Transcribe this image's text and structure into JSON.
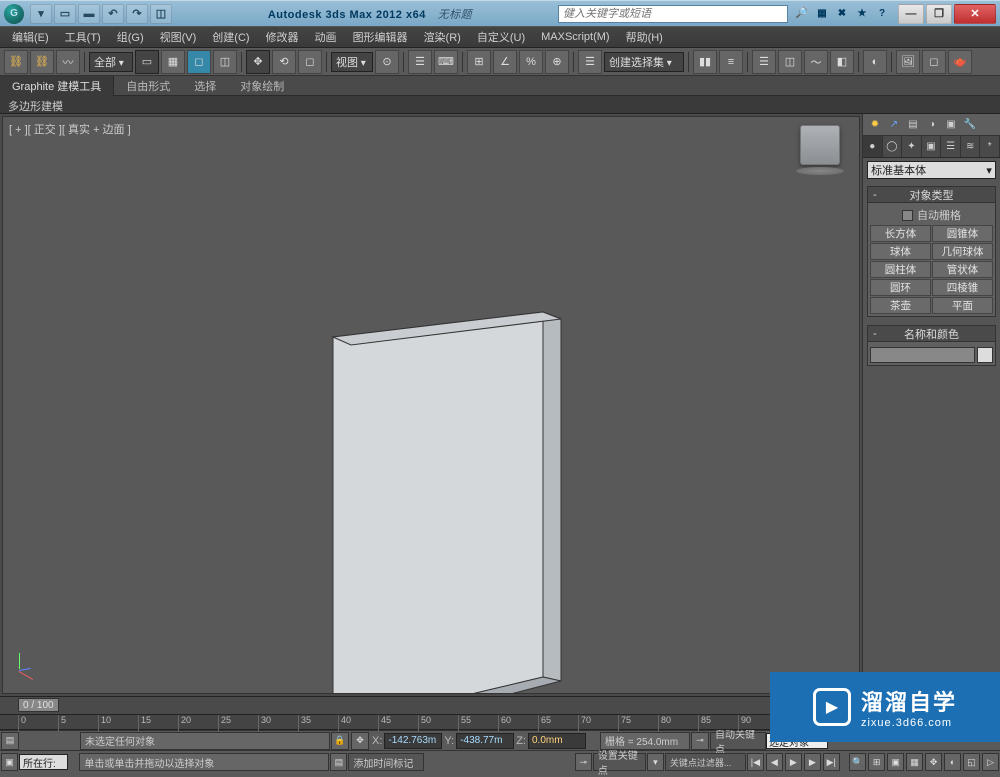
{
  "titlebar": {
    "app_title": "Autodesk 3ds Max  2012  x64",
    "file_title": "无标题",
    "search_placeholder": "健入关键字或短语",
    "minimize": "—",
    "maximize": "❐",
    "close": "✕"
  },
  "menubar": {
    "items": [
      "编辑(E)",
      "工具(T)",
      "组(G)",
      "视图(V)",
      "创建(C)",
      "修改器",
      "动画",
      "图形编辑器",
      "渲染(R)",
      "自定义(U)",
      "MAXScript(M)",
      "帮助(H)"
    ]
  },
  "toolbar": {
    "selset_label": "全部",
    "view_label": "视图",
    "named_sel_label": "创建选择集"
  },
  "ribbon": {
    "tabs": [
      "Graphite 建模工具",
      "自由形式",
      "选择",
      "对象绘制"
    ],
    "sub_label": "多边形建模"
  },
  "viewport": {
    "label": "[ + ][ 正交 ][ 真实 + 边面 ]"
  },
  "cmdpanel": {
    "category_label": "标准基本体",
    "rollout_objtype": "对象类型",
    "auto_grid": "自动栅格",
    "primitives": [
      [
        "长方体",
        "圆锥体"
      ],
      [
        "球体",
        "几何球体"
      ],
      [
        "圆柱体",
        "管状体"
      ],
      [
        "圆环",
        "四棱锥"
      ],
      [
        "茶壶",
        "平面"
      ]
    ],
    "rollout_namecolor": "名称和颜色"
  },
  "timeline": {
    "marker": "0 / 100",
    "ticks": [
      "0",
      "5",
      "10",
      "15",
      "20",
      "25",
      "30",
      "35",
      "40",
      "45",
      "50",
      "55",
      "60",
      "65",
      "70",
      "75",
      "80",
      "85",
      "90"
    ]
  },
  "status": {
    "selection_msg": "未选定任何对象",
    "prompt_msg": "单击或单击并拖动以选择对象",
    "layer_label": "所在行:",
    "x_label": "X:",
    "y_label": "Y:",
    "z_label": "Z:",
    "x_val": "-142.763m",
    "y_val": "-438.77m",
    "z_val": "0.0mm",
    "grid_label": "栅格 = 254.0mm",
    "add_time_tag": "添加时间标记",
    "autokey": "自动关键点",
    "setkey": "设置关键点",
    "selected_filter": "选定对象",
    "key_filters": "关键点过滤器..."
  },
  "watermark": {
    "main": "溜溜自学",
    "sub": "zixue.3d66.com"
  }
}
